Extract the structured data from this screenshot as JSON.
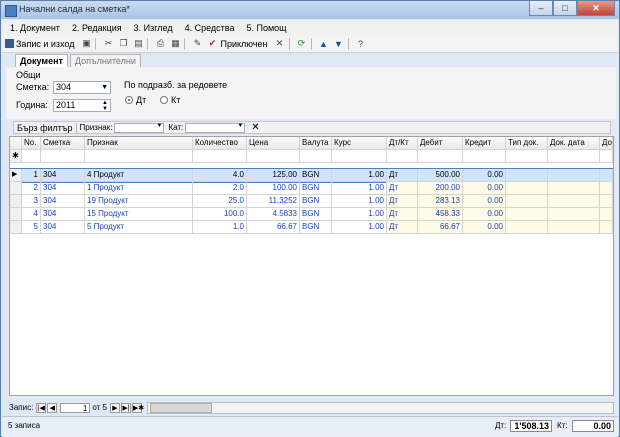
{
  "window": {
    "title": "Начални салда на сметка*"
  },
  "menu": [
    "1. Документ",
    "2. Редакция",
    "3. Изглед",
    "4. Средства",
    "5. Помощ"
  ],
  "toolbar": {
    "save_close": "Запис и изход",
    "finish": "Приключен"
  },
  "tabs": [
    "Документ",
    "Допълнителни"
  ],
  "form": {
    "group_general": "Общи",
    "account_label": "Сметка:",
    "account_value": "304",
    "year_label": "Година:",
    "year_value": "2011",
    "default_label": "По подразб. за редовете",
    "dt_label": "Дт",
    "kt_label": "Кт"
  },
  "filter": {
    "quick": "Бърз филтър",
    "attr_label": "Признак:",
    "cat_label": "Кат:"
  },
  "grid": {
    "headers": [
      "No.",
      "Сметка",
      "Признак",
      "Количество",
      "Цена",
      "Валута",
      "Курс",
      "Дт/Кт",
      "Дебит",
      "Кредит",
      "Тип док.",
      "Док. дата",
      "До"
    ],
    "rows": [
      {
        "no": "1",
        "account": "304",
        "attr": "4 Продукт",
        "qty": "4.0",
        "price": "125.00",
        "cur": "BGN",
        "rate": "1.00",
        "dk": "Дт",
        "debit": "500.00",
        "credit": "0.00"
      },
      {
        "no": "2",
        "account": "304",
        "attr": "1 Продукт",
        "qty": "2.0",
        "price": "100.00",
        "cur": "BGN",
        "rate": "1.00",
        "dk": "Дт",
        "debit": "200.00",
        "credit": "0.00"
      },
      {
        "no": "3",
        "account": "304",
        "attr": "19 Продукт",
        "qty": "25.0",
        "price": "11.3252",
        "cur": "BGN",
        "rate": "1.00",
        "dk": "Дт",
        "debit": "283.13",
        "credit": "0.00"
      },
      {
        "no": "4",
        "account": "304",
        "attr": "15 Продукт",
        "qty": "100.0",
        "price": "4.5833",
        "cur": "BGN",
        "rate": "1.00",
        "dk": "Дт",
        "debit": "458.33",
        "credit": "0.00"
      },
      {
        "no": "5",
        "account": "304",
        "attr": "5 Продукт",
        "qty": "1.0",
        "price": "66.67",
        "cur": "BGN",
        "rate": "1.00",
        "dk": "Дт",
        "debit": "66.67",
        "credit": "0.00"
      }
    ]
  },
  "nav": {
    "label": "Запис:",
    "current": "1",
    "of": "от 5"
  },
  "status": {
    "records": "5 записа",
    "dt_label": "Дт:",
    "dt_total": "1'508.13",
    "kt_label": "Кт:",
    "kt_total": "0.00"
  }
}
